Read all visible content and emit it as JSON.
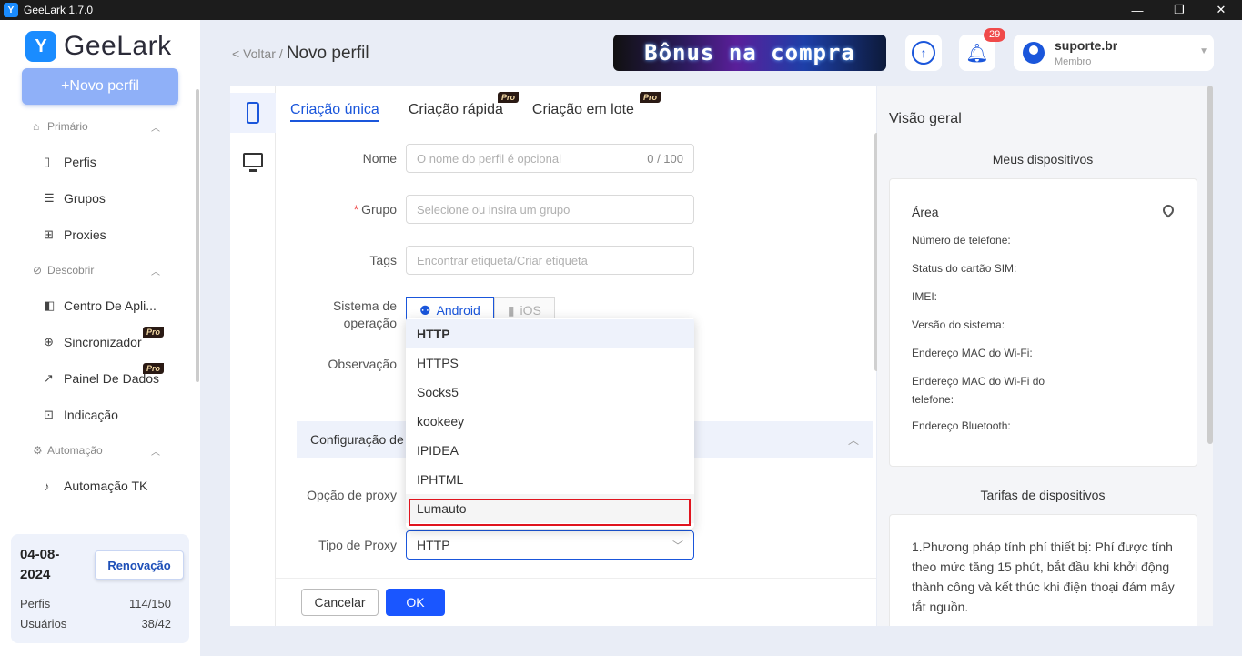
{
  "window": {
    "title": "GeeLark 1.7.0",
    "minimize": "—",
    "maximize": "❐",
    "close": "✕"
  },
  "sidebar": {
    "logo_text": "GeeLark",
    "new_profile_label": "+Novo perfil",
    "sections": [
      {
        "label": "Primário",
        "items": [
          "Perfis",
          "Grupos",
          "Proxies"
        ]
      },
      {
        "label": "Descobrir",
        "items": [
          "Centro De Apli...",
          "Sincronizador",
          "Painel De Dados",
          "Indicação"
        ]
      },
      {
        "label": "Automação",
        "items": [
          "Automação TK"
        ]
      }
    ],
    "pro_label": "Pro",
    "plan": {
      "date": "04-08-2024",
      "renew_label": "Renovação",
      "profiles_label": "Perfis",
      "profiles_value": "114/150",
      "users_label": "Usuários",
      "users_value": "38/42"
    }
  },
  "header": {
    "back_label": "< Voltar",
    "separator": "/",
    "title": "Novo perfil",
    "banner_text": "Bônus na compra",
    "notification_count": "29",
    "user_name": "suporte.br",
    "user_role": "Membro"
  },
  "tabs": [
    "Criação única",
    "Criação rápida",
    "Criação em lote"
  ],
  "form": {
    "name_label": "Nome",
    "name_placeholder": "O nome do perfil é opcional",
    "name_counter": "0 / 100",
    "group_label": "Grupo",
    "group_placeholder": "Selecione ou insira um grupo",
    "tags_label": "Tags",
    "tags_placeholder": "Encontrar etiqueta/Criar etiqueta",
    "os_label_1": "Sistema de",
    "os_label_2": "operação",
    "os_android": "Android",
    "os_ios": "iOS",
    "note_label": "Observação",
    "proxy_section": "Configuração de",
    "proxy_option_label": "Opção de proxy",
    "proxy_type_label": "Tipo de Proxy",
    "proxy_type_value": "HTTP",
    "cancel_label": "Cancelar",
    "ok_label": "OK"
  },
  "dropdown": {
    "options": [
      "HTTP",
      "HTTPS",
      "Socks5",
      "kookeey",
      "IPIDEA",
      "IPHTML",
      "Lumauto"
    ],
    "selected": "HTTP"
  },
  "overview": {
    "title": "Visão geral",
    "devices_title": "Meus dispositivos",
    "area_label": "Área",
    "fields": [
      "Número de telefone:",
      "Status do cartão SIM:",
      "IMEI:",
      "Versão do sistema:",
      "Endereço MAC do Wi-Fi:",
      "Endereço MAC do Wi-Fi do telefone:",
      "Endereço Bluetooth:"
    ],
    "rates_title": "Tarifas de dispositivos",
    "rates_text": "1.Phương pháp tính phí thiết bị: Phí được tính theo mức tăng 15 phút, bắt đầu khi khởi động thành công và kết thúc khi điện thoại đám mây tắt nguồn."
  },
  "colors": {
    "accent": "#1a56db",
    "highlight_frame": "#e0141e",
    "pro_tag_bg": "#2a1a14"
  }
}
